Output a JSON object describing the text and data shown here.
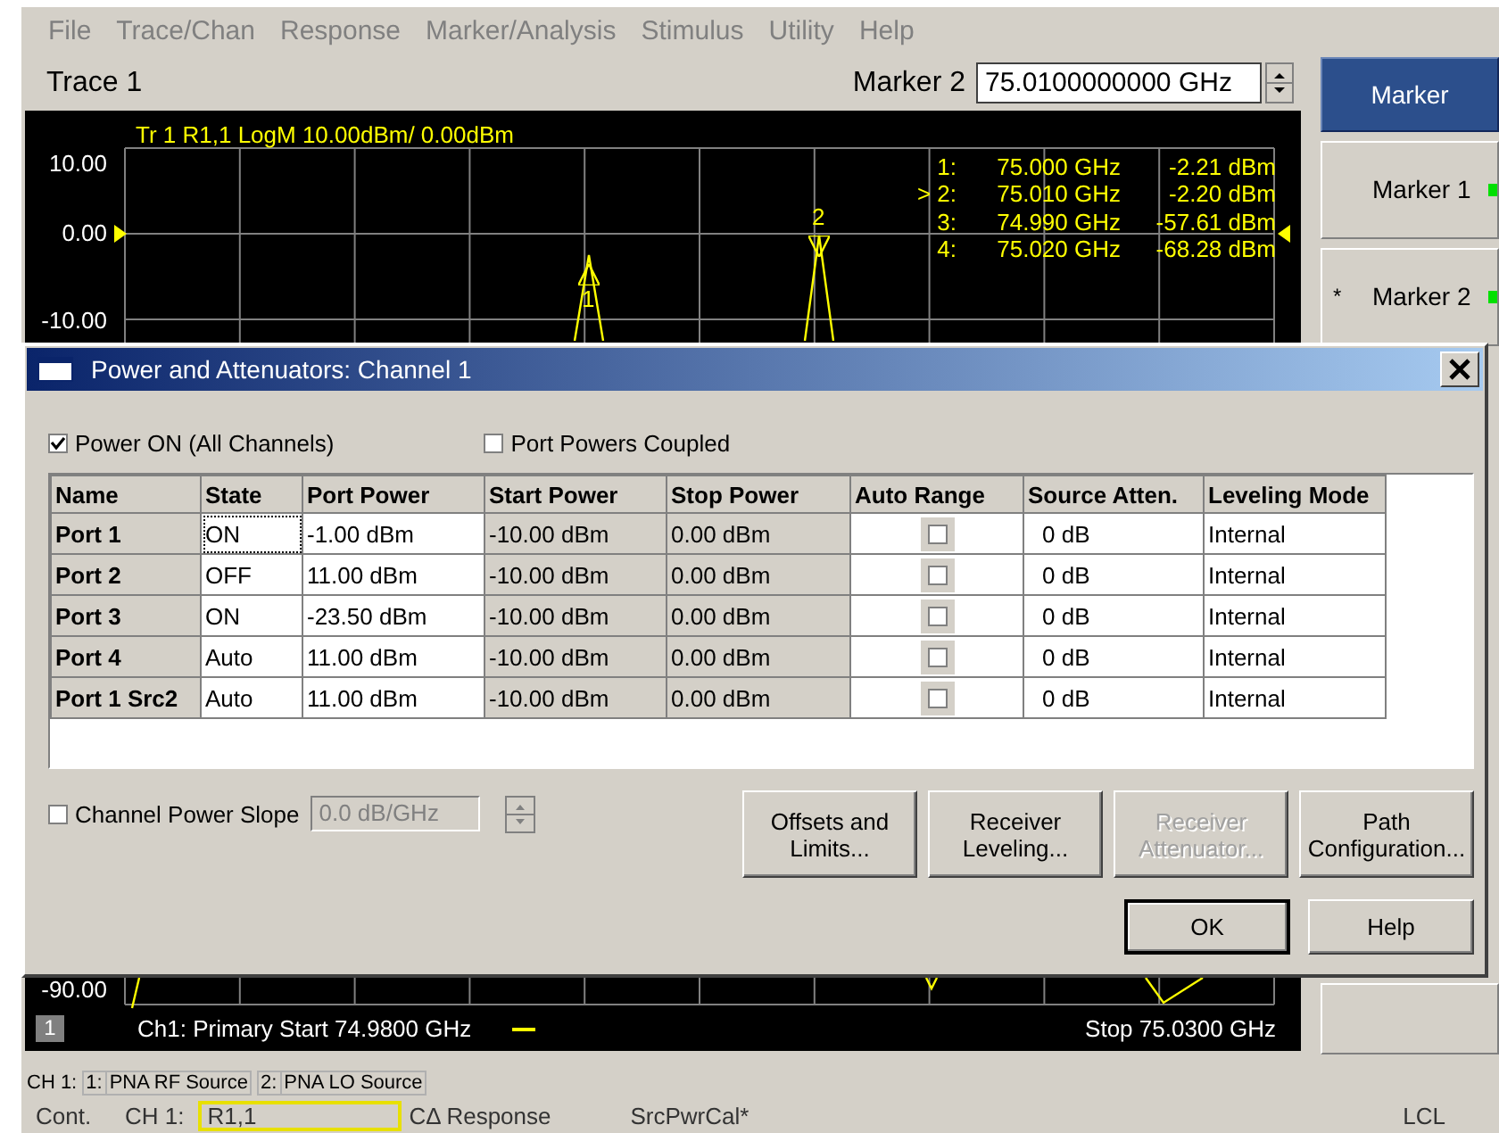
{
  "menu": [
    "File",
    "Trace/Chan",
    "Response",
    "Marker/Analysis",
    "Stimulus",
    "Utility",
    "Help"
  ],
  "trace_bar": {
    "title": "Trace 1",
    "marker_label": "Marker 2",
    "marker_value": "75.0100000000 GHz"
  },
  "chart": {
    "header": "Tr  1  R1,1 LogM 10.00dBm/  0.00dBm",
    "y_labels": [
      {
        "label": "10.00",
        "kind": "top"
      },
      {
        "label": "0.00",
        "kind": "ref"
      },
      {
        "label": "-10.00",
        "kind": "second"
      },
      {
        "label": "-90.00",
        "kind": "bottom"
      }
    ],
    "markers": [
      {
        "label": "1:",
        "frequency": "75.000 GHz",
        "value": "-2.21 dBm"
      },
      {
        "label": "> 2:",
        "frequency": "75.010 GHz",
        "value": "-2.20 dBm"
      },
      {
        "label": "3:",
        "frequency": "74.990 GHz",
        "value": "-57.61 dBm"
      },
      {
        "label": "4:",
        "frequency": "75.020 GHz",
        "value": "-68.28 dBm"
      }
    ],
    "trace_markers": [
      {
        "label": "1",
        "kind": "up"
      },
      {
        "label": "2",
        "kind": "down"
      }
    ],
    "channel_number": "1",
    "start": "Ch1: Primary Start  74.9800 GHz",
    "stop": "Stop  75.0300 GHz"
  },
  "softkeys": [
    {
      "kind": "title",
      "label": "Marker"
    },
    {
      "kind": "toggle",
      "label": "Marker 1",
      "on": true
    },
    {
      "kind": "toggle",
      "label": "Marker 2",
      "mark": "*",
      "on": true
    },
    {
      "kind": "blank"
    }
  ],
  "dialog": {
    "title": "Power and Attenuators: Channel 1",
    "power_on": {
      "label": "Power ON (All Channels)",
      "checked": true
    },
    "coupled": {
      "label": "Port Powers Coupled",
      "checked": false
    },
    "table": {
      "columns": [
        "Name",
        "State",
        "Port Power",
        "Start Power",
        "Stop Power",
        "Auto Range",
        "Source Atten.",
        "Leveling Mode"
      ],
      "rows": [
        {
          "name": "Port 1",
          "state": "ON",
          "port_power": "-1.00 dBm",
          "start_power": "-10.00 dBm",
          "stop_power": "0.00 dBm",
          "auto_range": false,
          "source_atten": "0 dB",
          "leveling_mode": "Internal",
          "selected": true
        },
        {
          "name": "Port 2",
          "state": "OFF",
          "port_power": "11.00 dBm",
          "start_power": "-10.00 dBm",
          "stop_power": "0.00 dBm",
          "auto_range": false,
          "source_atten": "0 dB",
          "leveling_mode": "Internal",
          "selected": false
        },
        {
          "name": "Port 3",
          "state": "ON",
          "port_power": "-23.50 dBm",
          "start_power": "-10.00 dBm",
          "stop_power": "0.00 dBm",
          "auto_range": false,
          "source_atten": "0 dB",
          "leveling_mode": "Internal",
          "selected": false
        },
        {
          "name": "Port 4",
          "state": "Auto",
          "port_power": "11.00 dBm",
          "start_power": "-10.00 dBm",
          "stop_power": "0.00 dBm",
          "auto_range": false,
          "source_atten": "0 dB",
          "leveling_mode": "Internal",
          "selected": false
        },
        {
          "name": "Port 1 Src2",
          "state": "Auto",
          "port_power": "11.00 dBm",
          "start_power": "-10.00 dBm",
          "stop_power": "0.00 dBm",
          "auto_range": false,
          "source_atten": "0 dB",
          "leveling_mode": "Internal",
          "selected": false
        }
      ]
    },
    "slope": {
      "label": "Channel Power Slope",
      "checked": false,
      "value": "0.0 dB/GHz",
      "disabled": true
    },
    "buttons": [
      {
        "label": "Offsets and Limits...",
        "disabled": false
      },
      {
        "label": "Receiver Leveling...",
        "disabled": false
      },
      {
        "label": "Receiver Attenuator...",
        "disabled": true
      },
      {
        "label": "Path Configuration...",
        "disabled": false
      }
    ],
    "ok": "OK",
    "help": "Help"
  },
  "channel_tabs": {
    "prefix": "CH 1:",
    "sources": [
      {
        "number": "1:",
        "name": "PNA RF Source"
      },
      {
        "number": "2:",
        "name": "PNA LO Source"
      }
    ]
  },
  "status_bar": {
    "mode": "Cont.",
    "channel": "CH 1:",
    "measurement": "R1,1",
    "correction": "CΔ Response",
    "cal": "SrcPwrCal*",
    "remote": "LCL"
  }
}
